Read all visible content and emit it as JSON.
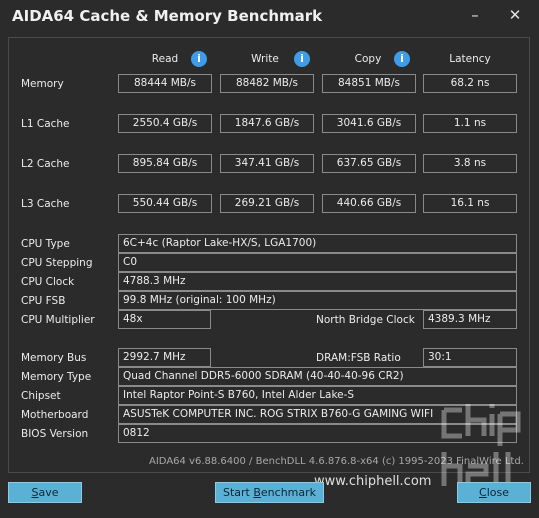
{
  "window": {
    "title": "AIDA64 Cache & Memory Benchmark",
    "minimize_glyph": "–",
    "close_glyph": "✕"
  },
  "headers": {
    "read": "Read",
    "write": "Write",
    "copy": "Copy",
    "latency": "Latency",
    "info_glyph": "i"
  },
  "rows": {
    "memory": {
      "label": "Memory",
      "read": "88444 MB/s",
      "write": "88482 MB/s",
      "copy": "84851 MB/s",
      "latency": "68.2 ns"
    },
    "l1": {
      "label": "L1 Cache",
      "read": "2550.4 GB/s",
      "write": "1847.6 GB/s",
      "copy": "3041.6 GB/s",
      "latency": "1.1 ns"
    },
    "l2": {
      "label": "L2 Cache",
      "read": "895.84 GB/s",
      "write": "347.41 GB/s",
      "copy": "637.65 GB/s",
      "latency": "3.8 ns"
    },
    "l3": {
      "label": "L3 Cache",
      "read": "550.44 GB/s",
      "write": "269.21 GB/s",
      "copy": "440.66 GB/s",
      "latency": "16.1 ns"
    }
  },
  "cpu": {
    "type_label": "CPU Type",
    "type_value": "6C+4c   (Raptor Lake-HX/S, LGA1700)",
    "stepping_label": "CPU Stepping",
    "stepping_value": "C0",
    "clock_label": "CPU Clock",
    "clock_value": "4788.3 MHz",
    "fsb_label": "CPU FSB",
    "fsb_value": "99.8 MHz  (original: 100 MHz)",
    "multiplier_label": "CPU Multiplier",
    "multiplier_value": "48x",
    "nb_clock_label": "North Bridge Clock",
    "nb_clock_value": "4389.3 MHz"
  },
  "memory_info": {
    "bus_label": "Memory Bus",
    "bus_value": "2992.7 MHz",
    "ratio_label": "DRAM:FSB Ratio",
    "ratio_value": "30:1",
    "type_label": "Memory Type",
    "type_value": "Quad Channel DDR5-6000 SDRAM  (40-40-40-96 CR2)",
    "chipset_label": "Chipset",
    "chipset_value": "Intel Raptor Point-S B760, Intel Alder Lake-S",
    "motherboard_label": "Motherboard",
    "motherboard_value": "ASUSTeK COMPUTER INC. ROG STRIX B760-G GAMING WIFI",
    "bios_label": "BIOS Version",
    "bios_value": "0812"
  },
  "footer": {
    "text": "AIDA64 v6.88.6400 / BenchDLL 4.6.876.8-x64  (c) 1995-2023 FinalWire Ltd."
  },
  "buttons": {
    "save_first": "S",
    "save_rest": "ave",
    "start_pre": "Start ",
    "start_u": "B",
    "start_post": "enchmark",
    "close_first": "C",
    "close_rest": "lose"
  },
  "watermark": {
    "url": "www.chiphell.com",
    "logo_word": "chip hell"
  },
  "colors": {
    "info_icon": "#3e9ce8",
    "button_bg": "#5bb0d6",
    "background": "#2b2b2b",
    "box_border": "#8a8a8a"
  }
}
